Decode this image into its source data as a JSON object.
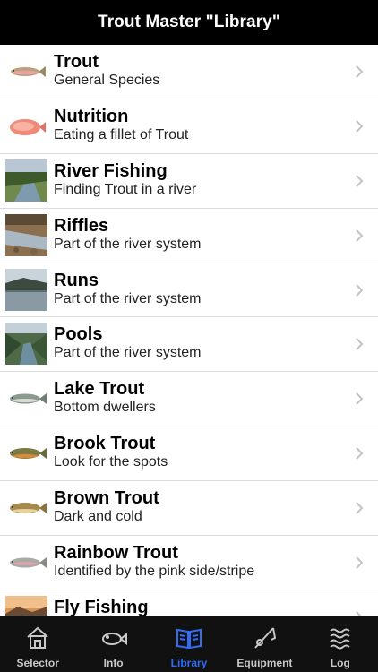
{
  "header": {
    "title": "Trout Master \"Library\""
  },
  "items": [
    {
      "title": "Trout",
      "subtitle": "General Species",
      "icon": "trout-fish-image"
    },
    {
      "title": "Nutrition",
      "subtitle": "Eating a fillet of Trout",
      "icon": "trout-fillet-image"
    },
    {
      "title": "River Fishing",
      "subtitle": "Finding Trout in a river",
      "icon": "river-photo"
    },
    {
      "title": "Riffles",
      "subtitle": "Part of the river system",
      "icon": "riffles-photo"
    },
    {
      "title": "Runs",
      "subtitle": "Part of the river system",
      "icon": "runs-photo"
    },
    {
      "title": "Pools",
      "subtitle": "Part of the river system",
      "icon": "pools-photo"
    },
    {
      "title": "Lake Trout",
      "subtitle": "Bottom dwellers",
      "icon": "lake-trout-image"
    },
    {
      "title": "Brook Trout",
      "subtitle": "Look for the spots",
      "icon": "brook-trout-image"
    },
    {
      "title": "Brown Trout",
      "subtitle": "Dark and cold",
      "icon": "brown-trout-image"
    },
    {
      "title": "Rainbow Trout",
      "subtitle": "Identified by the pink side/stripe",
      "icon": "rainbow-trout-image"
    },
    {
      "title": "Fly Fishing",
      "subtitle": "",
      "icon": "fly-fishing-photo"
    }
  ],
  "tabs": [
    {
      "label": "Selector",
      "icon": "house-icon",
      "active": false
    },
    {
      "label": "Info",
      "icon": "fish-icon",
      "active": false
    },
    {
      "label": "Library",
      "icon": "book-icon",
      "active": true
    },
    {
      "label": "Equipment",
      "icon": "fishing-rod-icon",
      "active": false
    },
    {
      "label": "Log",
      "icon": "waves-icon",
      "active": false
    }
  ],
  "colors": {
    "active_tab": "#2f6df5",
    "navbar": "#000000",
    "tabbar": "#111111"
  }
}
